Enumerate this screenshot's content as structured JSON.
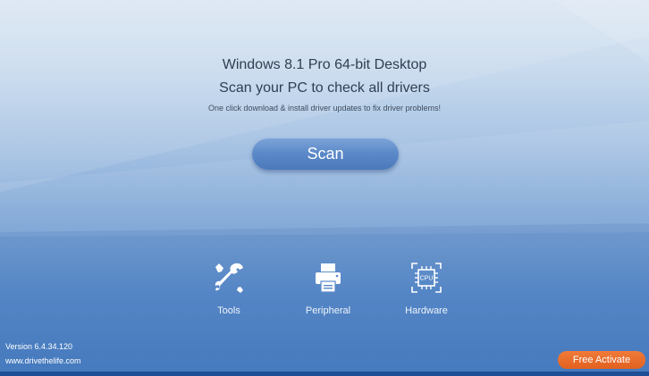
{
  "header": {
    "os_line": "Windows 8.1 Pro 64-bit Desktop",
    "headline": "Scan your PC to check all drivers",
    "subtitle": "One click download & install driver updates to fix driver problems!"
  },
  "scan": {
    "label": "Scan"
  },
  "features": {
    "tools": {
      "label": "Tools",
      "icon": "wrench-screwdriver-icon"
    },
    "peripheral": {
      "label": "Peripheral",
      "icon": "printer-icon"
    },
    "hardware": {
      "label": "Hardware",
      "icon": "cpu-chip-icon",
      "chip_text": "CPU"
    }
  },
  "footer": {
    "version": "Version 6.4.34.120",
    "website": "www.drivethelife.com",
    "activate_label": "Free Activate"
  },
  "colors": {
    "accent_blue": "#5a88c8",
    "activate_orange": "#e9692a",
    "text_dark": "#2f3f52"
  }
}
